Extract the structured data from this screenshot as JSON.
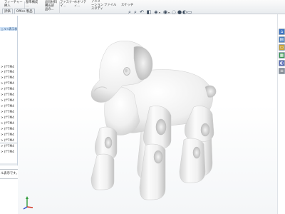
{
  "ribbon": {
    "items": [
      {
        "label": "フィーチャー\n挿入"
      },
      {
        "label": "基準構成\n..."
      },
      {
        "label": "品目材料\n構成部\n品の..."
      },
      {
        "label": "ファスナー\nマ..."
      },
      {
        "label": "ネオリテ\nィ..."
      },
      {
        "label": "アニメ\nーション\nスタディ"
      },
      {
        "label": "\nファイル"
      },
      {
        "label": "\nスケッチ"
      }
    ]
  },
  "tabs": [
    {
      "label": "評価"
    },
    {
      "label": "Office 製品"
    }
  ],
  "hud": {
    "icons": [
      "zoom-to-fit-icon",
      "zoom-area-icon",
      "previous-view-icon",
      "section-view-icon",
      "view-orientation-icon",
      "display-style-icon",
      "hide-show-icon",
      "edit-appearance-icon",
      "apply-scene-icon",
      "view-settings-icon"
    ]
  },
  "feature_tree": {
    "selected_label": "ェル<表示状",
    "rows": [
      "> (f\"7M4",
      "> (f\"7M4",
      "> (f\"7M4",
      "> (f\"7M4",
      "> (f\"7M4",
      "> (f\"7M4",
      "> (f\"7M4",
      "> (f\"7M4",
      "> (f\"7M4",
      "> (f\"7M4",
      "> (f\"7M4",
      "> (f\"7M4",
      "> (f\"7M4",
      "> (f\"7M4",
      "> (f\"7M4",
      "> (f\"7M4"
    ]
  },
  "tooltip": {
    "text": "ル表示です。"
  },
  "task_pane": {
    "buttons": [
      {
        "icon": "home-icon",
        "color": "#3e74c4"
      },
      {
        "icon": "design-library-icon",
        "color": "#4a7fbf"
      },
      {
        "icon": "file-explorer-icon",
        "color": "#c9a23c"
      },
      {
        "icon": "view-palette-icon",
        "color": "#3c9a54"
      },
      {
        "icon": "appearances-icon",
        "color": "#5c6fb8"
      },
      {
        "icon": "custom-properties-icon",
        "color": "#8a8f96"
      }
    ]
  },
  "triad": {
    "x_color": "#d23a2a",
    "y_color": "#2f9a3a",
    "z_color": "#2b4fd1"
  },
  "colors": {
    "model": "#f2f2f2",
    "ribbon_bg": "#eef1f4",
    "selection": "#cfe3f8"
  }
}
